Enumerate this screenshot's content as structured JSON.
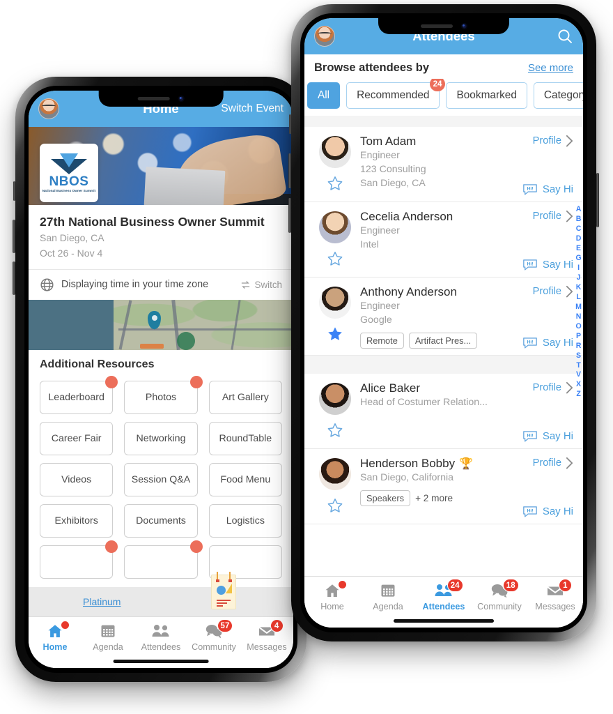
{
  "left_phone": {
    "header": {
      "title": "Home",
      "right_action": "Switch Event",
      "avatar": "user-avatar"
    },
    "banner": {
      "logo_word": "NBOS",
      "logo_sub": "National Business Owner Summit"
    },
    "event": {
      "title": "27th National Business Owner Summit",
      "location": "San Diego, CA",
      "dates": "Oct 26 - Nov 4"
    },
    "timezone": {
      "text": "Displaying time in your time zone",
      "switch_label": "Switch",
      "icon": "globe-icon"
    },
    "resources": {
      "title": "Additional Resources",
      "items": [
        {
          "label": "Leaderboard",
          "badge": true
        },
        {
          "label": "Photos",
          "badge": true
        },
        {
          "label": "Art Gallery",
          "badge": false
        },
        {
          "label": "Career Fair",
          "badge": false
        },
        {
          "label": "Networking",
          "badge": false
        },
        {
          "label": "RoundTable",
          "badge": false
        },
        {
          "label": "Videos",
          "badge": false
        },
        {
          "label": "Session Q&A",
          "badge": false
        },
        {
          "label": "Food Menu",
          "badge": false
        },
        {
          "label": "Exhibitors",
          "badge": false
        },
        {
          "label": "Documents",
          "badge": false
        },
        {
          "label": "Logistics",
          "badge": false
        },
        {
          "label": "",
          "badge": true
        },
        {
          "label": "",
          "badge": true
        },
        {
          "label": "",
          "badge": false
        }
      ]
    },
    "sponsor": {
      "label": "Platinum"
    },
    "tabs": [
      {
        "label": "Home",
        "icon": "home-icon",
        "active": true,
        "dot": true,
        "badge": ""
      },
      {
        "label": "Agenda",
        "icon": "calendar-icon",
        "active": false,
        "dot": false,
        "badge": ""
      },
      {
        "label": "Attendees",
        "icon": "people-icon",
        "active": false,
        "dot": false,
        "badge": ""
      },
      {
        "label": "Community",
        "icon": "chat-icon",
        "active": false,
        "dot": false,
        "badge": "57"
      },
      {
        "label": "Messages",
        "icon": "envelope-icon",
        "active": false,
        "dot": false,
        "badge": "4"
      }
    ]
  },
  "right_phone": {
    "header": {
      "title": "Attendees",
      "avatar": "user-avatar",
      "search": "search-icon"
    },
    "browse": {
      "label": "Browse attendees by",
      "see_more": "See more"
    },
    "chips": [
      {
        "label": "All",
        "selected": true,
        "badge": ""
      },
      {
        "label": "Recommended",
        "selected": false,
        "badge": "24"
      },
      {
        "label": "Bookmarked",
        "selected": false,
        "badge": ""
      },
      {
        "label": "Category",
        "selected": false,
        "badge": ""
      }
    ],
    "attendees": [
      {
        "name": "Tom Adam",
        "title": "Engineer",
        "company": "123 Consulting",
        "location": "San Diego, CA",
        "tags": [],
        "more": "",
        "bookmarked": false,
        "trophy": false,
        "profile_label": "Profile",
        "sayhi_label": "Say Hi"
      },
      {
        "name": "Cecelia Anderson",
        "title": "Engineer",
        "company": "Intel",
        "location": "",
        "tags": [],
        "more": "",
        "bookmarked": false,
        "trophy": false,
        "profile_label": "Profile",
        "sayhi_label": "Say Hi"
      },
      {
        "name": "Anthony Anderson",
        "title": "Engineer",
        "company": "Google",
        "location": "",
        "tags": [
          "Remote",
          "Artifact Pres..."
        ],
        "more": "",
        "bookmarked": true,
        "trophy": false,
        "profile_label": "Profile",
        "sayhi_label": "Say Hi"
      },
      {
        "name": "Alice Baker",
        "title": "Head of Costumer Relation...",
        "company": "",
        "location": "",
        "tags": [],
        "more": "",
        "bookmarked": false,
        "trophy": false,
        "profile_label": "Profile",
        "sayhi_label": "Say Hi"
      },
      {
        "name": "Henderson Bobby",
        "title": "San Diego, California",
        "company": "",
        "location": "",
        "tags": [
          "Speakers"
        ],
        "more": "+ 2 more",
        "bookmarked": false,
        "trophy": true,
        "profile_label": "Profile",
        "sayhi_label": "Say Hi"
      }
    ],
    "alpha_index": [
      "A",
      "B",
      "C",
      "D",
      "E",
      "G",
      "I",
      "J",
      "K",
      "L",
      "M",
      "N",
      "O",
      "P",
      "R",
      "S",
      "T",
      "V",
      "X",
      "Z"
    ],
    "tabs": [
      {
        "label": "Home",
        "icon": "home-icon",
        "active": false,
        "dot": true,
        "badge": ""
      },
      {
        "label": "Agenda",
        "icon": "calendar-icon",
        "active": false,
        "dot": false,
        "badge": ""
      },
      {
        "label": "Attendees",
        "icon": "people-icon",
        "active": true,
        "dot": false,
        "badge": "24"
      },
      {
        "label": "Community",
        "icon": "chat-icon",
        "active": false,
        "dot": false,
        "badge": "18"
      },
      {
        "label": "Messages",
        "icon": "envelope-icon",
        "active": false,
        "dot": false,
        "badge": "1"
      }
    ]
  },
  "colors": {
    "brand_blue": "#57ace4",
    "link_blue": "#3b8fd4",
    "badge_red": "#e8392c",
    "badge_coral": "#ec6e5a",
    "text_dark": "#2d2d2d",
    "text_muted": "#9e9e9e"
  }
}
